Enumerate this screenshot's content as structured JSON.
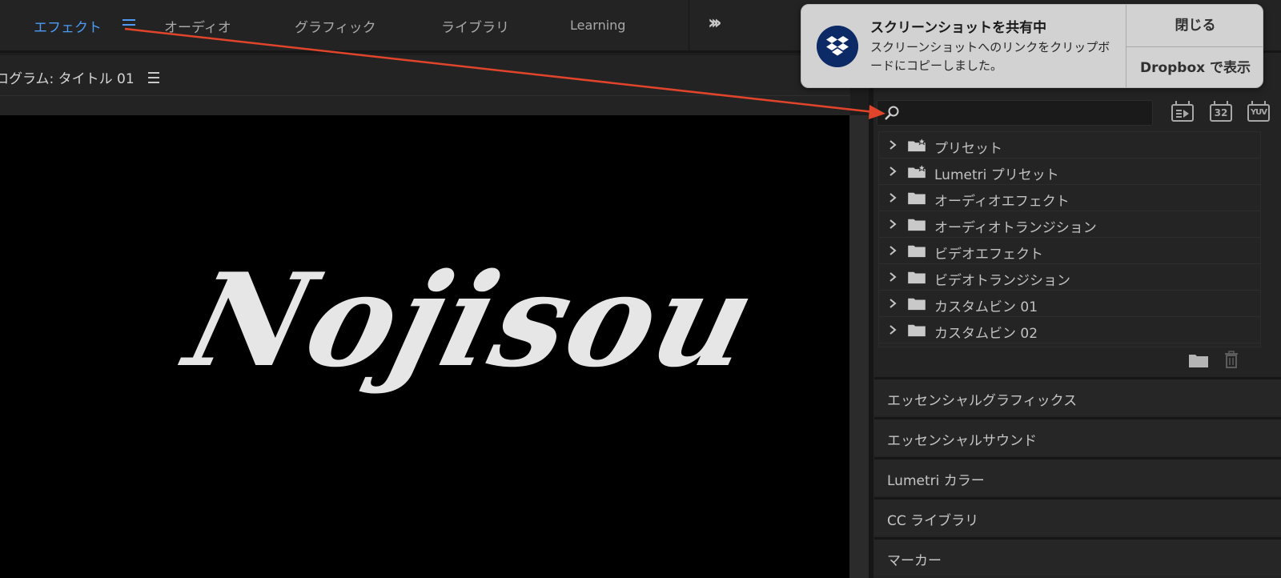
{
  "workspaces": {
    "tabs": [
      {
        "label": "エフェクト",
        "active": true
      },
      {
        "label": "オーディオ"
      },
      {
        "label": "グラフィック"
      },
      {
        "label": "ライブラリ"
      },
      {
        "label": "Learning"
      }
    ],
    "more_icon": "double-chevron-right-icon"
  },
  "program": {
    "title": "ログラム: タイトル 01",
    "title_text": "Nojisou"
  },
  "effects": {
    "search": {
      "value": "",
      "placeholder": ""
    },
    "toolbar_icons": [
      "accelerated-effects-icon",
      "32-bit-color-icon",
      "yuv-effects-icon"
    ],
    "badge_32": "32",
    "badge_yuv": "YUV",
    "tree": [
      {
        "label": "プリセット",
        "icon": "preset-folder-icon"
      },
      {
        "label": "Lumetri プリセット",
        "icon": "preset-folder-icon"
      },
      {
        "label": "オーディオエフェクト",
        "icon": "folder-icon"
      },
      {
        "label": "オーディオトランジション",
        "icon": "folder-icon"
      },
      {
        "label": "ビデオエフェクト",
        "icon": "folder-icon"
      },
      {
        "label": "ビデオトランジション",
        "icon": "folder-icon"
      },
      {
        "label": "カスタムビン 01",
        "icon": "folder-icon"
      },
      {
        "label": "カスタムビン 02",
        "icon": "folder-icon"
      }
    ]
  },
  "panels": [
    {
      "label": "エッセンシャルグラフィックス"
    },
    {
      "label": "エッセンシャルサウンド"
    },
    {
      "label": "Lumetri カラー"
    },
    {
      "label": "CC ライブラリ"
    },
    {
      "label": "マーカー"
    }
  ],
  "notification": {
    "title": "スクリーンショットを共有中",
    "body": "スクリーンショットへのリンクをクリップボードにコピーしました。",
    "close_label": "閉じる",
    "show_label": "Dropbox で表示"
  },
  "colors": {
    "accent": "#4d9bf5",
    "annotation_arrow": "#e0452c",
    "dropbox_blue": "#0c2b66"
  }
}
